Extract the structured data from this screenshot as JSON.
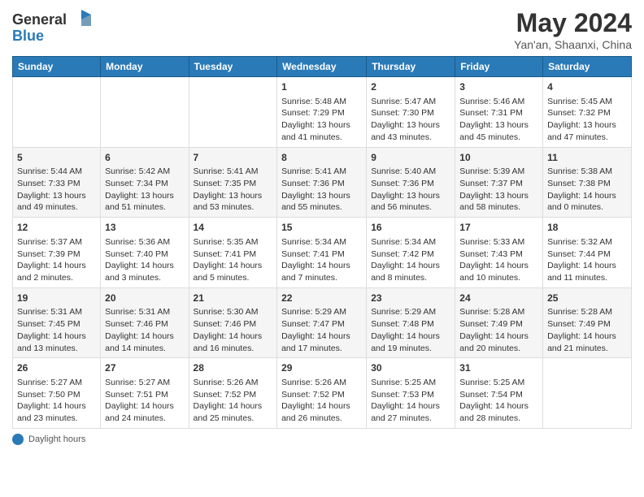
{
  "header": {
    "logo_line1": "General",
    "logo_line2": "Blue",
    "month_year": "May 2024",
    "location": "Yan'an, Shaanxi, China"
  },
  "days_of_week": [
    "Sunday",
    "Monday",
    "Tuesday",
    "Wednesday",
    "Thursday",
    "Friday",
    "Saturday"
  ],
  "weeks": [
    [
      {
        "day": "",
        "info": ""
      },
      {
        "day": "",
        "info": ""
      },
      {
        "day": "",
        "info": ""
      },
      {
        "day": "1",
        "info": "Sunrise: 5:48 AM\nSunset: 7:29 PM\nDaylight: 13 hours and 41 minutes."
      },
      {
        "day": "2",
        "info": "Sunrise: 5:47 AM\nSunset: 7:30 PM\nDaylight: 13 hours and 43 minutes."
      },
      {
        "day": "3",
        "info": "Sunrise: 5:46 AM\nSunset: 7:31 PM\nDaylight: 13 hours and 45 minutes."
      },
      {
        "day": "4",
        "info": "Sunrise: 5:45 AM\nSunset: 7:32 PM\nDaylight: 13 hours and 47 minutes."
      }
    ],
    [
      {
        "day": "5",
        "info": "Sunrise: 5:44 AM\nSunset: 7:33 PM\nDaylight: 13 hours and 49 minutes."
      },
      {
        "day": "6",
        "info": "Sunrise: 5:42 AM\nSunset: 7:34 PM\nDaylight: 13 hours and 51 minutes."
      },
      {
        "day": "7",
        "info": "Sunrise: 5:41 AM\nSunset: 7:35 PM\nDaylight: 13 hours and 53 minutes."
      },
      {
        "day": "8",
        "info": "Sunrise: 5:41 AM\nSunset: 7:36 PM\nDaylight: 13 hours and 55 minutes."
      },
      {
        "day": "9",
        "info": "Sunrise: 5:40 AM\nSunset: 7:36 PM\nDaylight: 13 hours and 56 minutes."
      },
      {
        "day": "10",
        "info": "Sunrise: 5:39 AM\nSunset: 7:37 PM\nDaylight: 13 hours and 58 minutes."
      },
      {
        "day": "11",
        "info": "Sunrise: 5:38 AM\nSunset: 7:38 PM\nDaylight: 14 hours and 0 minutes."
      }
    ],
    [
      {
        "day": "12",
        "info": "Sunrise: 5:37 AM\nSunset: 7:39 PM\nDaylight: 14 hours and 2 minutes."
      },
      {
        "day": "13",
        "info": "Sunrise: 5:36 AM\nSunset: 7:40 PM\nDaylight: 14 hours and 3 minutes."
      },
      {
        "day": "14",
        "info": "Sunrise: 5:35 AM\nSunset: 7:41 PM\nDaylight: 14 hours and 5 minutes."
      },
      {
        "day": "15",
        "info": "Sunrise: 5:34 AM\nSunset: 7:41 PM\nDaylight: 14 hours and 7 minutes."
      },
      {
        "day": "16",
        "info": "Sunrise: 5:34 AM\nSunset: 7:42 PM\nDaylight: 14 hours and 8 minutes."
      },
      {
        "day": "17",
        "info": "Sunrise: 5:33 AM\nSunset: 7:43 PM\nDaylight: 14 hours and 10 minutes."
      },
      {
        "day": "18",
        "info": "Sunrise: 5:32 AM\nSunset: 7:44 PM\nDaylight: 14 hours and 11 minutes."
      }
    ],
    [
      {
        "day": "19",
        "info": "Sunrise: 5:31 AM\nSunset: 7:45 PM\nDaylight: 14 hours and 13 minutes."
      },
      {
        "day": "20",
        "info": "Sunrise: 5:31 AM\nSunset: 7:46 PM\nDaylight: 14 hours and 14 minutes."
      },
      {
        "day": "21",
        "info": "Sunrise: 5:30 AM\nSunset: 7:46 PM\nDaylight: 14 hours and 16 minutes."
      },
      {
        "day": "22",
        "info": "Sunrise: 5:29 AM\nSunset: 7:47 PM\nDaylight: 14 hours and 17 minutes."
      },
      {
        "day": "23",
        "info": "Sunrise: 5:29 AM\nSunset: 7:48 PM\nDaylight: 14 hours and 19 minutes."
      },
      {
        "day": "24",
        "info": "Sunrise: 5:28 AM\nSunset: 7:49 PM\nDaylight: 14 hours and 20 minutes."
      },
      {
        "day": "25",
        "info": "Sunrise: 5:28 AM\nSunset: 7:49 PM\nDaylight: 14 hours and 21 minutes."
      }
    ],
    [
      {
        "day": "26",
        "info": "Sunrise: 5:27 AM\nSunset: 7:50 PM\nDaylight: 14 hours and 23 minutes."
      },
      {
        "day": "27",
        "info": "Sunrise: 5:27 AM\nSunset: 7:51 PM\nDaylight: 14 hours and 24 minutes."
      },
      {
        "day": "28",
        "info": "Sunrise: 5:26 AM\nSunset: 7:52 PM\nDaylight: 14 hours and 25 minutes."
      },
      {
        "day": "29",
        "info": "Sunrise: 5:26 AM\nSunset: 7:52 PM\nDaylight: 14 hours and 26 minutes."
      },
      {
        "day": "30",
        "info": "Sunrise: 5:25 AM\nSunset: 7:53 PM\nDaylight: 14 hours and 27 minutes."
      },
      {
        "day": "31",
        "info": "Sunrise: 5:25 AM\nSunset: 7:54 PM\nDaylight: 14 hours and 28 minutes."
      },
      {
        "day": "",
        "info": ""
      }
    ]
  ],
  "footer": {
    "label": "Daylight hours"
  }
}
